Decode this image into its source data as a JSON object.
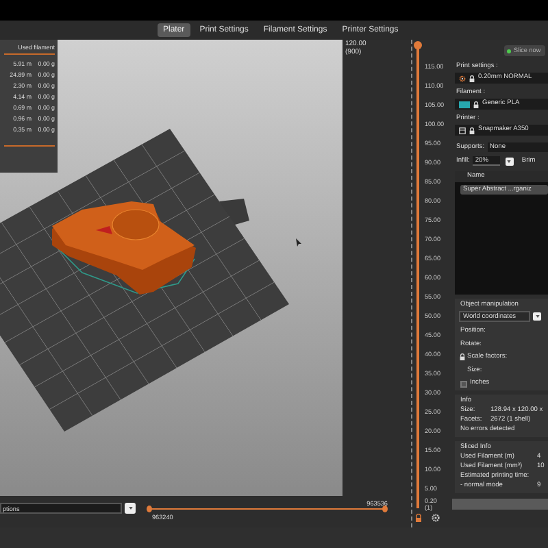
{
  "tabs": [
    {
      "label": "Plater",
      "selected": true
    },
    {
      "label": "Print Settings",
      "selected": false
    },
    {
      "label": "Filament Settings",
      "selected": false
    },
    {
      "label": "Printer Settings",
      "selected": false
    }
  ],
  "legend": {
    "header": "Used filament",
    "rows": [
      {
        "length": "5.91 m",
        "weight": "0.00 g"
      },
      {
        "length": "24.89 m",
        "weight": "0.00 g"
      },
      {
        "length": "2.30 m",
        "weight": "0.00 g"
      },
      {
        "length": "4.14 m",
        "weight": "0.00 g"
      },
      {
        "length": "0.69 m",
        "weight": "0.00 g"
      },
      {
        "length": "0.96 m",
        "weight": "0.00 g"
      },
      {
        "length": "0.35 m",
        "weight": "0.00 g"
      }
    ]
  },
  "layer_slider": {
    "top_value": "120.00",
    "top_layer": "(900)",
    "ticks": [
      "115.00",
      "110.00",
      "105.00",
      "100.00",
      "95.00",
      "90.00",
      "85.00",
      "80.00",
      "75.00",
      "70.00",
      "65.00",
      "60.00",
      "55.00",
      "50.00",
      "45.00",
      "40.00",
      "35.00",
      "30.00",
      "25.00",
      "20.00",
      "15.00",
      "10.00",
      "5.00"
    ],
    "bottom_value": "0.20",
    "bottom_layer": "(1)"
  },
  "bottom_bar": {
    "view_field": "ptions",
    "move_end": "963536",
    "move_start": "963240"
  },
  "panel": {
    "slice_button": {
      "label": "Slice now",
      "disabled": true
    },
    "presets": [
      {
        "kind": "print",
        "label": "Print settings :",
        "value": "0.20mm NORMAL"
      },
      {
        "kind": "filament",
        "label": "Filament :",
        "value": "Generic PLA",
        "color": "#27a7ae"
      },
      {
        "kind": "printer",
        "label": "Printer :",
        "value": "Snapmaker A350"
      }
    ],
    "supports": {
      "label": "Supports:",
      "value": "None"
    },
    "infill": {
      "label": "Infill:",
      "value": "20%"
    },
    "brim": {
      "label": "Brim"
    },
    "objects": {
      "header": "Name",
      "items": [
        {
          "name": "Super Abstract ...rganiz",
          "selected": true
        }
      ]
    },
    "manipulation": {
      "title": "Object manipulation",
      "coordinates": "World coordinates",
      "rows": [
        "Position:",
        "Rotate:"
      ],
      "scale_label": "Scale factors:",
      "size_label": "Size:",
      "inches": {
        "label": "Inches",
        "checked": false
      }
    },
    "info": {
      "title": "Info",
      "rows": [
        {
          "label": "Size:",
          "value": "128.94 x 120.00 x"
        },
        {
          "label": "Facets:",
          "value": "2672 (1 shell)"
        }
      ],
      "note": "No errors detected"
    },
    "sliced_info": {
      "title": "Sliced Info",
      "rows": [
        {
          "label": "Used Filament (m)",
          "value": "4"
        },
        {
          "label": "Used Filament (mm³)",
          "value": "10"
        }
      ],
      "estimate_title": "Estimated printing time:",
      "modes": [
        {
          "label": "- normal mode",
          "value": "9"
        }
      ]
    }
  }
}
